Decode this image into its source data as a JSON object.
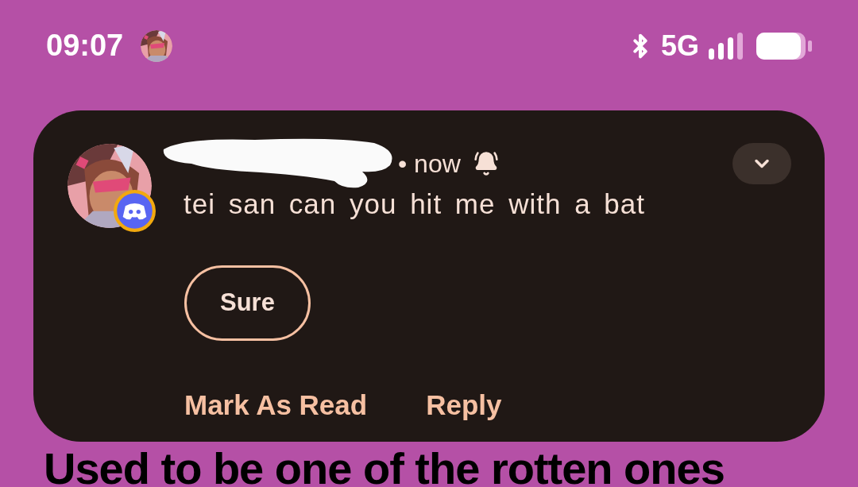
{
  "status_bar": {
    "time": "09:07",
    "network": "5G"
  },
  "notification": {
    "meta": "• now",
    "message": "tei san can you hit me with a bat",
    "expanded": false,
    "quick_replies": [
      "Sure"
    ],
    "actions": [
      "Mark As Read",
      "Reply"
    ]
  },
  "background_text": "Used to be one of the rotten ones"
}
